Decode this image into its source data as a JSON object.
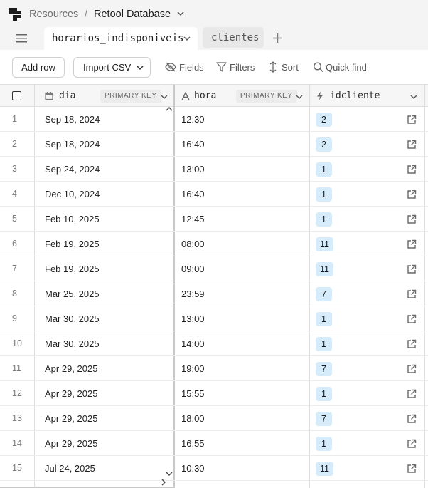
{
  "breadcrumb": {
    "resources": "Resources",
    "separator": "/",
    "database": "Retool Database"
  },
  "tabs": [
    {
      "label": "horarios_indisponiveis",
      "active": true
    },
    {
      "label": "clientes",
      "active": false
    }
  ],
  "toolbar": {
    "add_row": "Add row",
    "import_csv": "Import CSV",
    "fields": "Fields",
    "filters": "Filters",
    "sort": "Sort",
    "quick_find": "Quick find"
  },
  "columns": [
    {
      "name": "dia",
      "badge": "PRIMARY KEY",
      "icon": "calendar-icon"
    },
    {
      "name": "hora",
      "badge": "PRIMARY KEY",
      "icon": "text-type-icon"
    },
    {
      "name": "idcliente",
      "badge": "",
      "icon": "lightning-icon"
    }
  ],
  "rows": [
    {
      "n": "1",
      "dia": "Sep 18, 2024",
      "hora": "12:30",
      "idcliente": "2"
    },
    {
      "n": "2",
      "dia": "Sep 18, 2024",
      "hora": "16:40",
      "idcliente": "2"
    },
    {
      "n": "3",
      "dia": "Sep 24, 2024",
      "hora": "13:00",
      "idcliente": "1"
    },
    {
      "n": "4",
      "dia": "Dec 10, 2024",
      "hora": "16:40",
      "idcliente": "1"
    },
    {
      "n": "5",
      "dia": "Feb 10, 2025",
      "hora": "12:45",
      "idcliente": "1"
    },
    {
      "n": "6",
      "dia": "Feb 19, 2025",
      "hora": "08:00",
      "idcliente": "11"
    },
    {
      "n": "7",
      "dia": "Feb 19, 2025",
      "hora": "09:00",
      "idcliente": "11"
    },
    {
      "n": "8",
      "dia": "Mar 25, 2025",
      "hora": "23:59",
      "idcliente": "7"
    },
    {
      "n": "9",
      "dia": "Mar 30, 2025",
      "hora": "13:00",
      "idcliente": "1"
    },
    {
      "n": "10",
      "dia": "Mar 30, 2025",
      "hora": "14:00",
      "idcliente": "1"
    },
    {
      "n": "11",
      "dia": "Apr 29, 2025",
      "hora": "19:00",
      "idcliente": "7"
    },
    {
      "n": "12",
      "dia": "Apr 29, 2025",
      "hora": "15:55",
      "idcliente": "1"
    },
    {
      "n": "13",
      "dia": "Apr 29, 2025",
      "hora": "18:00",
      "idcliente": "7"
    },
    {
      "n": "14",
      "dia": "Apr 29, 2025",
      "hora": "16:55",
      "idcliente": "1"
    },
    {
      "n": "15",
      "dia": "Jul 24, 2025",
      "hora": "10:30",
      "idcliente": "11"
    }
  ],
  "colors": {
    "chip_bg": "#d6ecfb",
    "header_bg": "#f4f4f4"
  }
}
